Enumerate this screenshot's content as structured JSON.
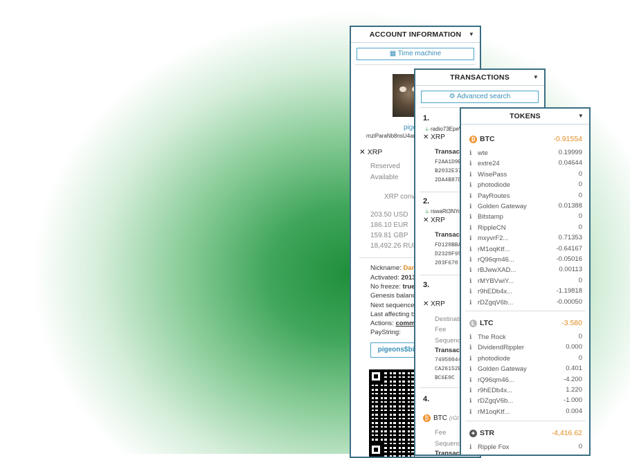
{
  "account": {
    "title": "ACCOUNT INFORMATION",
    "time_machine": "Time machine",
    "name": "pige",
    "address": "rnziParaNb8nsU4aru",
    "xrp_label": "XRP",
    "reserved_label": "Reserved",
    "available_label": "Available",
    "xrp_converted": "XRP conve",
    "fiat": [
      "203.50 USD",
      "186.10 EUR",
      "159.81 GBP",
      "18,492.26 RUB"
    ],
    "nickname_label": "Nickname:",
    "nickname_value": "Dan",
    "activated_label": "Activated:",
    "activated_value": "2013-",
    "nofreeze_label": "No freeze:",
    "nofreeze_value": "true",
    "genesis_label": "Genesis balanc",
    "next_seq_label": "Next sequence:",
    "last_tx_label": "Last affecting tx",
    "actions_label": "Actions:",
    "actions_value": "comme",
    "paystring_label": "PayString:",
    "paystring_value": "pigeons$bi"
  },
  "transactions": {
    "title": "TRANSACTIONS",
    "advanced_search": "Advanced search",
    "items": [
      {
        "num": "1.",
        "from": "radio73EpeW",
        "cur": "XRP",
        "tx_label": "Transact",
        "hash": [
          "F2AA1D9E",
          "B2032E37",
          "2DA4B87D"
        ]
      },
      {
        "num": "2.",
        "from": "rswaRt3NYo",
        "cur": "XRP",
        "tx_label": "Transact",
        "hash": [
          "FD120BBA",
          "D2320F95",
          "203F670"
        ]
      },
      {
        "num": "3.",
        "cur": "XRP",
        "dest_label": "Destinati",
        "fee_label": "Fee",
        "seq_label": "Sequenc",
        "tx_label": "Transact",
        "hash": [
          "749500449",
          "CA26152B",
          "BC6E0C"
        ]
      },
      {
        "num": "4.",
        "cur": "BTC",
        "cur_note": "(rGt",
        "fee_label": "Fee",
        "seq_label": "Sequence",
        "tx_label": "Transact"
      }
    ]
  },
  "tokens": {
    "title": "TOKENS",
    "groups": [
      {
        "currency": "BTC",
        "total": "-0.91554",
        "coin_color": "#f0912b",
        "coin_glyph": "₿",
        "issuers": [
          {
            "name": "wte",
            "value": "0.19999"
          },
          {
            "name": "extre24",
            "value": "0.04644"
          },
          {
            "name": "WisePass",
            "value": "0"
          },
          {
            "name": "photodiode",
            "value": "0"
          },
          {
            "name": "PayRoutes",
            "value": "0"
          },
          {
            "name": "Golden Gateway",
            "value": "0.01388"
          },
          {
            "name": "Bitstamp",
            "value": "0"
          },
          {
            "name": "RippleCN",
            "value": "0"
          },
          {
            "name": "mxyvrF2...",
            "value": "0.71353"
          },
          {
            "name": "rM1oqKtf...",
            "value": "-0.64167"
          },
          {
            "name": "rQ96qm46...",
            "value": "-0.05016"
          },
          {
            "name": "rBJwwXAD...",
            "value": "0.00113"
          },
          {
            "name": "rMYBVwiY...",
            "value": "0"
          },
          {
            "name": "r9hEDb4x...",
            "value": "-1.19818"
          },
          {
            "name": "rDZgqV6b...",
            "value": "-0.00050"
          }
        ]
      },
      {
        "currency": "LTC",
        "total": "-3.580",
        "coin_color": "#b8b8b8",
        "coin_glyph": "Ł",
        "issuers": [
          {
            "name": "The Rock",
            "value": "0"
          },
          {
            "name": "DividendRippler",
            "value": "0.000"
          },
          {
            "name": "photodiode",
            "value": "0"
          },
          {
            "name": "Golden Gateway",
            "value": "0.401"
          },
          {
            "name": "rQ96qm46...",
            "value": "-4.200"
          },
          {
            "name": "r9hEDb4x...",
            "value": "1.220"
          },
          {
            "name": "rDZgqV6b...",
            "value": "-1.000"
          },
          {
            "name": "rM1oqKtf...",
            "value": "0.004"
          }
        ]
      },
      {
        "currency": "STR",
        "total": "-4,416.62",
        "coin_color": "#555555",
        "coin_glyph": "✦",
        "issuers": [
          {
            "name": "Ripple Fox",
            "value": "0"
          }
        ]
      }
    ]
  }
}
